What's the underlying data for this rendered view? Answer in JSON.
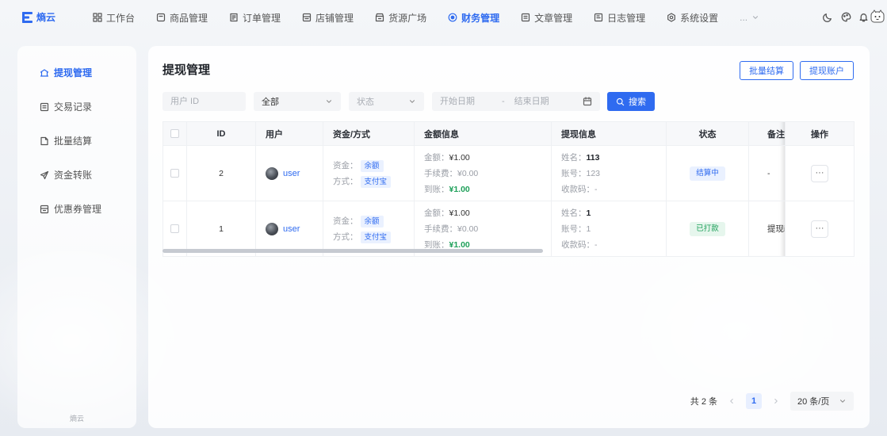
{
  "theme": {
    "accent": "#2f6bf0",
    "success": "#1fa05a"
  },
  "app": {
    "name": "熵云",
    "logo_icon": "logo-icon",
    "sidebar_footer": "熵云"
  },
  "topnav": {
    "items": [
      {
        "label": "工作台",
        "icon": "dashboard-icon"
      },
      {
        "label": "商品管理",
        "icon": "product-icon"
      },
      {
        "label": "订单管理",
        "icon": "order-icon"
      },
      {
        "label": "店铺管理",
        "icon": "store-icon"
      },
      {
        "label": "货源广场",
        "icon": "supply-icon"
      },
      {
        "label": "财务管理",
        "icon": "finance-icon",
        "active": true
      },
      {
        "label": "文章管理",
        "icon": "article-icon"
      },
      {
        "label": "日志管理",
        "icon": "log-icon"
      },
      {
        "label": "系统设置",
        "icon": "settings-icon"
      }
    ],
    "more_label": "...",
    "right_icons": [
      "moon-icon",
      "palette-icon",
      "bell-icon",
      "user-avatar"
    ]
  },
  "sidebar": {
    "items": [
      {
        "label": "提现管理",
        "icon": "withdraw-icon",
        "active": true
      },
      {
        "label": "交易记录",
        "icon": "transaction-icon"
      },
      {
        "label": "批量结算",
        "icon": "batch-icon"
      },
      {
        "label": "资金转账",
        "icon": "transfer-icon"
      },
      {
        "label": "优惠券管理",
        "icon": "coupon-icon"
      }
    ]
  },
  "page": {
    "title": "提现管理",
    "buttons": {
      "batch_settle": "批量结算",
      "withdraw_accounts": "提现账户"
    }
  },
  "filters": {
    "user_id_placeholder": "用户 ID",
    "type_value": "全部",
    "status_placeholder": "状态",
    "start_date_placeholder": "开始日期",
    "range_separator": "-",
    "end_date_placeholder": "结束日期",
    "search_label": "搜索"
  },
  "table": {
    "columns": [
      "ID",
      "用户",
      "资金/方式",
      "金额信息",
      "提现信息",
      "状态",
      "备注",
      "操作"
    ],
    "labels": {
      "fund": "资金：",
      "method": "方式：",
      "amount": "金额：",
      "fee": "手续费：",
      "received": "到账：",
      "name": "姓名：",
      "account": "账号：",
      "qrcode": "收款码："
    },
    "rows": [
      {
        "id": "2",
        "user": "user",
        "fund": "余额",
        "method": "支付宝",
        "amount": "¥1.00",
        "fee": "¥0.00",
        "received": "¥1.00",
        "name": "113",
        "account": "123",
        "qrcode": "-",
        "status": "结算中",
        "remark": "-",
        "actions_label": "···"
      },
      {
        "id": "1",
        "user": "user",
        "fund": "余额",
        "method": "支付宝",
        "amount": "¥1.00",
        "fee": "¥0.00",
        "received": "¥1.00",
        "name": "1",
        "account": "1",
        "qrcode": "-",
        "status": "已打款",
        "remark": "提现i",
        "actions_label": "···"
      }
    ]
  },
  "pagination": {
    "total_text": "共 2 条",
    "current_page": "1",
    "page_size": "20 条/页"
  }
}
